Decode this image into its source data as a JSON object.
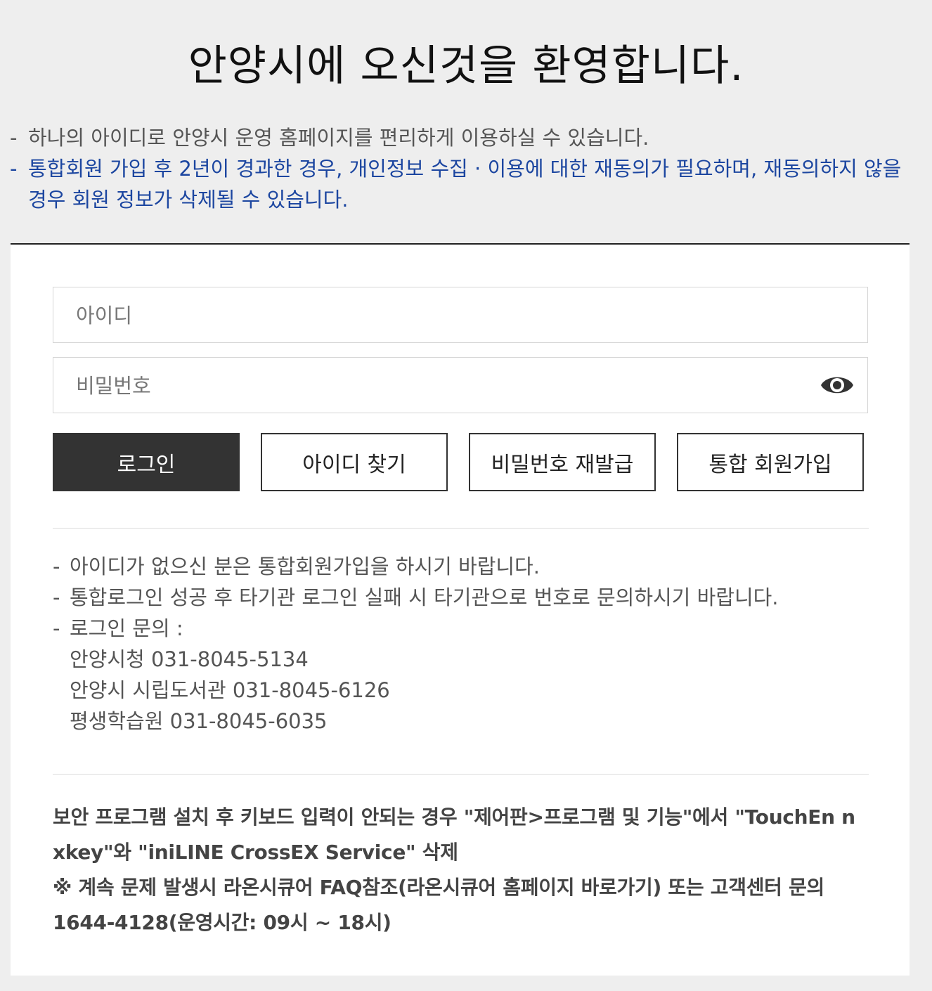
{
  "page": {
    "title": "안양시에 오신것을 환영합니다."
  },
  "notice": {
    "line1": "하나의 아이디로 안양시 운영 홈페이지를 편리하게 이용하실 수 있습니다.",
    "line2a": "통합회원 가입 후 2년이 경과한 경우, 개인정보 수집 · 이용에 대한 재동의가 필요하며, 재동의하지 않을",
    "line2b": "경우 회원 정보가 삭제될 수 있습니다."
  },
  "form": {
    "id_placeholder": "아이디",
    "password_placeholder": "비밀번호",
    "id_value": "",
    "password_value": ""
  },
  "buttons": {
    "login": "로그인",
    "find_id": "아이디 찾기",
    "reset_password": "비밀번호 재발급",
    "signup": "통합 회원가입"
  },
  "info": {
    "line1": "아이디가 없으신 분은 통합회원가입을 하시기 바랍니다.",
    "line2": "통합로그인 성공 후 타기관 로그인 실패 시 타기관으로 번호로 문의하시기 바랍니다.",
    "line3": "로그인 문의 :",
    "contacts": [
      "안양시청 031-8045-5134",
      "안양시 시립도서관 031-8045-6126",
      "평생학습원 031-8045-6035"
    ]
  },
  "security": {
    "line1": "보안 프로그램 설치 후 키보드 입력이 안되는 경우 \"제어판>프로그램 및 기능\"에서 \"TouchEn n",
    "line2": "xkey\"와 \"iniLINE CrossEX Service\" 삭제",
    "line3": "※ 계속 문제 발생시 라온시큐어 FAQ참조(라온시큐어 홈페이지 바로가기) 또는 고객센터 문의",
    "line4": "1644-4128(운영시간: 09시 ~ 18시)"
  },
  "icons": {
    "password_toggle": "eye-icon"
  },
  "colors": {
    "notice_blue": "#1c46a0",
    "button_dark": "#333333",
    "background": "#eeeeee"
  }
}
